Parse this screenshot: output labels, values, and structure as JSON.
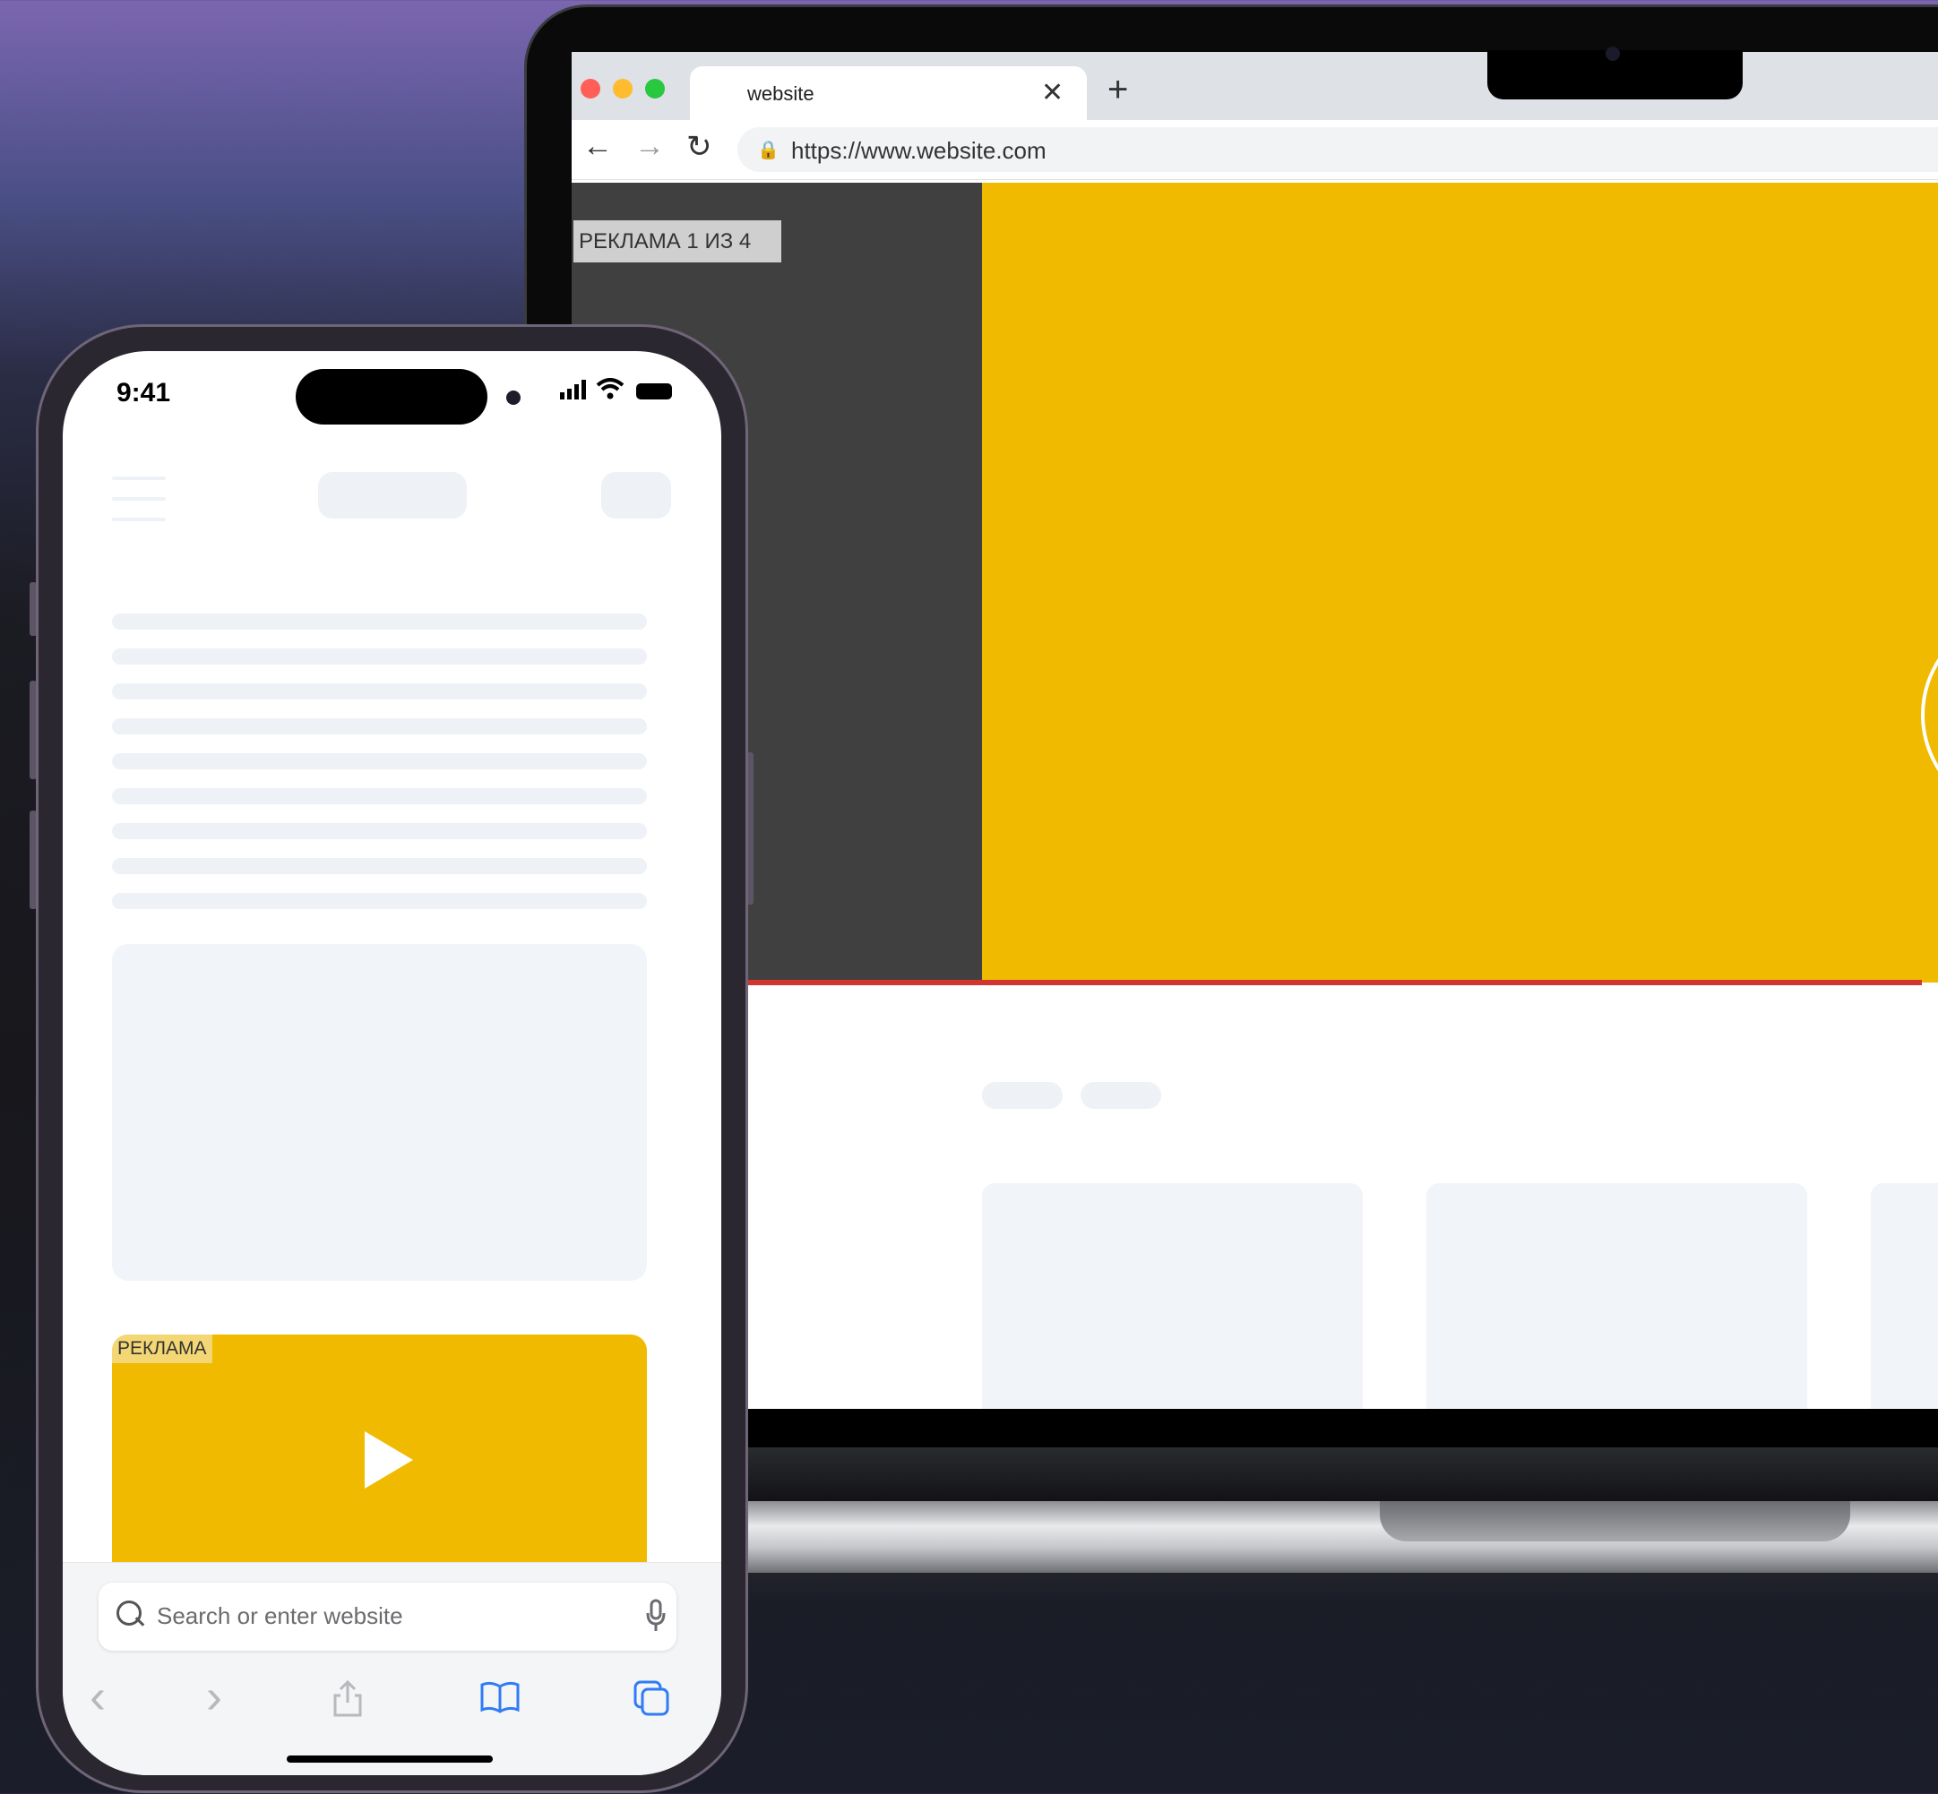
{
  "browser": {
    "tab_title": "website",
    "tab_close": "✕",
    "new_tab": "+",
    "back": "←",
    "forward": "→",
    "reload": "↻",
    "lock": "🔒",
    "url": "https://www.website.com"
  },
  "desktop_page": {
    "ad_label": "РЕКЛАМА 1 ИЗ 4",
    "ad_color": "#f0ba00",
    "progress_color": "#d0352f"
  },
  "phone": {
    "status_time": "9:41",
    "ad_label": "РЕКЛАМА",
    "search_placeholder": "Search or enter website",
    "toolbar": {
      "back": "‹",
      "forward": "›",
      "share": "⇪",
      "bookmarks": "📖",
      "tabs": "⧉"
    }
  },
  "icons": [
    "close-icon",
    "plus-icon",
    "back-arrow-icon",
    "forward-arrow-icon",
    "reload-icon",
    "lock-icon",
    "play-icon",
    "search-icon",
    "mic-icon",
    "share-icon",
    "bookmarks-icon",
    "tabs-icon",
    "signal-icon",
    "wifi-icon",
    "battery-icon"
  ]
}
